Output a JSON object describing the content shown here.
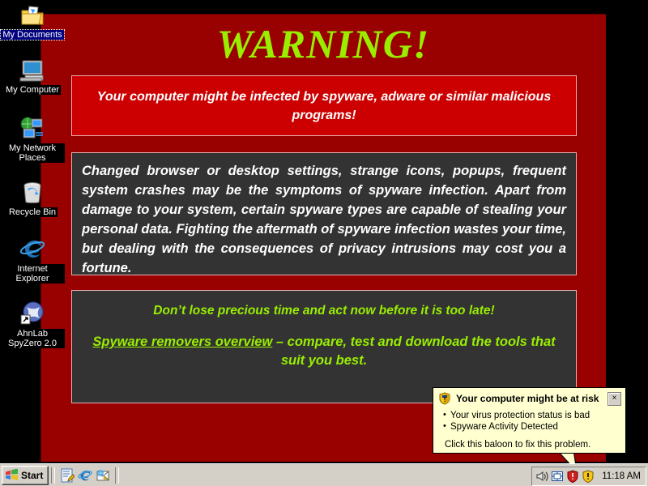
{
  "desktop": {
    "icons": [
      {
        "label": "My Documents",
        "icon": "folder-documents-icon",
        "selected": true
      },
      {
        "label": "My Computer",
        "icon": "computer-icon",
        "selected": false
      },
      {
        "label": "My Network Places",
        "icon": "network-places-icon",
        "selected": false
      },
      {
        "label": "Recycle Bin",
        "icon": "recycle-bin-icon",
        "selected": false
      },
      {
        "label": "Internet Explorer",
        "icon": "internet-explorer-icon",
        "selected": false
      },
      {
        "label": "AhnLab SpyZero 2.0",
        "icon": "ahnlab-spyzero-icon",
        "selected": false
      }
    ]
  },
  "wallpaper": {
    "title": "WARNING!",
    "alert_box": "Your computer might be infected by spyware, adware or similar malicious programs!",
    "body": "Changed browser or desktop settings, strange icons, popups, frequent system crashes may be the symptoms of spyware infection. Apart from damage to your system, certain spyware types are capable of stealing your personal data. Fighting the aftermath of spyware infection wastes your time, but dealing with the consequences of privacy intrusions may cost you a fortune.",
    "cta_headline": "Don’t lose precious time and act now before it is too late!",
    "cta_link": "Spyware removers overview",
    "cta_rest": " – compare, test and download the tools that suit you best.",
    "colors": {
      "background_red": "#990000",
      "alert_red": "#cc0000",
      "panel_gray": "#333333",
      "accent_green": "#99ee00",
      "text_white": "#ffffff"
    }
  },
  "balloon": {
    "title": "Your computer might be at risk",
    "shield_icon": "shield-warning-icon",
    "close_label": "×",
    "close_icon": "close-icon",
    "bullets": [
      "Your virus protection status is bad",
      "Spyware Activity Detected"
    ],
    "footer": "Click this baloon to fix this problem.",
    "background": "#ffffd0"
  },
  "taskbar": {
    "start_label": "Start",
    "start_icon": "windows-flag-icon",
    "quick_launch": [
      {
        "name": "show-desktop-icon"
      },
      {
        "name": "internet-explorer-icon"
      },
      {
        "name": "outlook-express-icon"
      }
    ],
    "tray_icons": [
      {
        "name": "volume-icon"
      },
      {
        "name": "network-connection-icon"
      },
      {
        "name": "security-alert-shield-icon"
      },
      {
        "name": "spyware-warning-shield-icon"
      }
    ],
    "clock": "11:18 AM"
  }
}
